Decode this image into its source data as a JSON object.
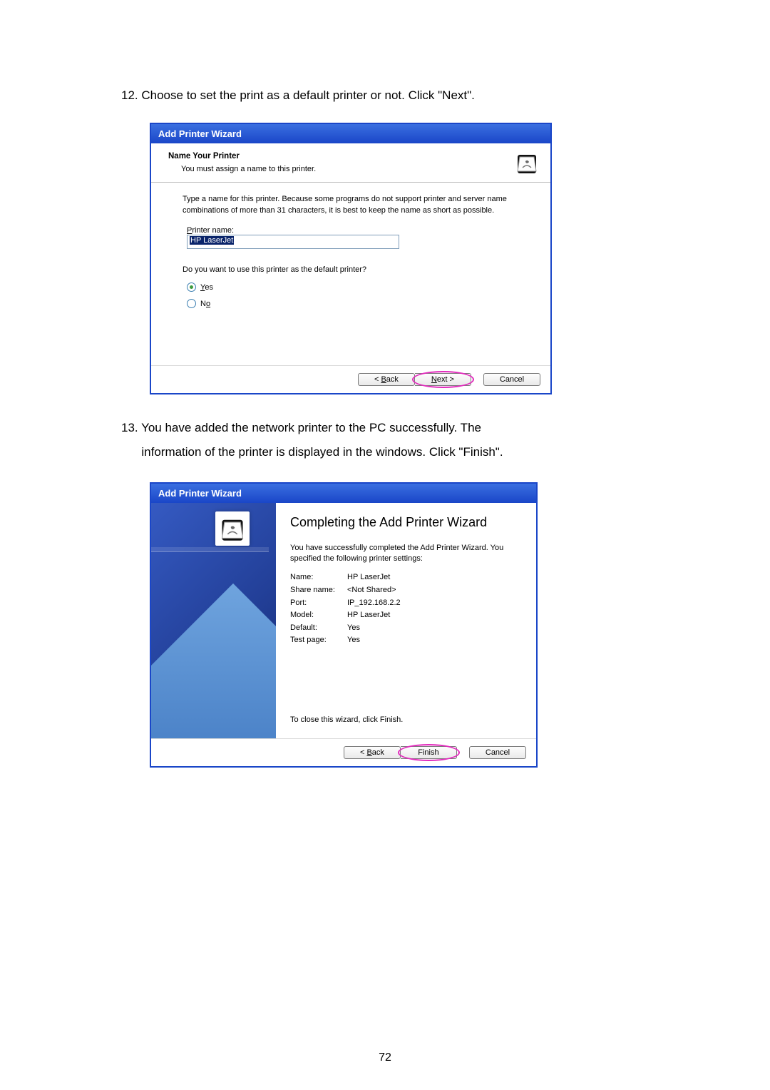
{
  "step12": {
    "number": "12.",
    "text": "Choose to set the print as a default printer or not. Click \"Next\"."
  },
  "step13": {
    "number": "13.",
    "text_line1": "You have added the network printer to the PC successfully. The",
    "text_line2": "information of the printer is displayed in the windows. Click \"Finish\"."
  },
  "wizard1": {
    "title": "Add Printer Wizard",
    "header_title": "Name Your Printer",
    "header_sub": "You must assign a name to this printer.",
    "body_text": "Type a name for this printer. Because some programs do not support printer and server name combinations of more than 31 characters, it is best to keep the name as short as possible.",
    "name_label_pre": "P",
    "name_label_post": "rinter name:",
    "name_value": "HP LaserJet",
    "default_q": "Do you want to use this printer as the default printer?",
    "yes_pre": "Y",
    "yes_post": "es",
    "no_pre": "N",
    "no_post": "o",
    "back_pre": "< ",
    "back_u": "B",
    "back_post": "ack",
    "next_u": "N",
    "next_post": "ext >",
    "cancel": "Cancel"
  },
  "wizard2": {
    "title": "Add Printer Wizard",
    "heading": "Completing the Add Printer Wizard",
    "desc": "You have successfully completed the Add Printer Wizard. You specified the following printer settings:",
    "rows": {
      "name_l": "Name:",
      "name_v": "HP LaserJet",
      "share_l": "Share name:",
      "share_v": "<Not Shared>",
      "port_l": "Port:",
      "port_v": "IP_192.168.2.2",
      "model_l": "Model:",
      "model_v": "HP LaserJet",
      "default_l": "Default:",
      "default_v": "Yes",
      "test_l": "Test page:",
      "test_v": "Yes"
    },
    "close_msg": "To close this wizard, click Finish.",
    "back_pre": "< ",
    "back_u": "B",
    "back_post": "ack",
    "finish": "Finish",
    "cancel": "Cancel"
  },
  "page_num": "72"
}
